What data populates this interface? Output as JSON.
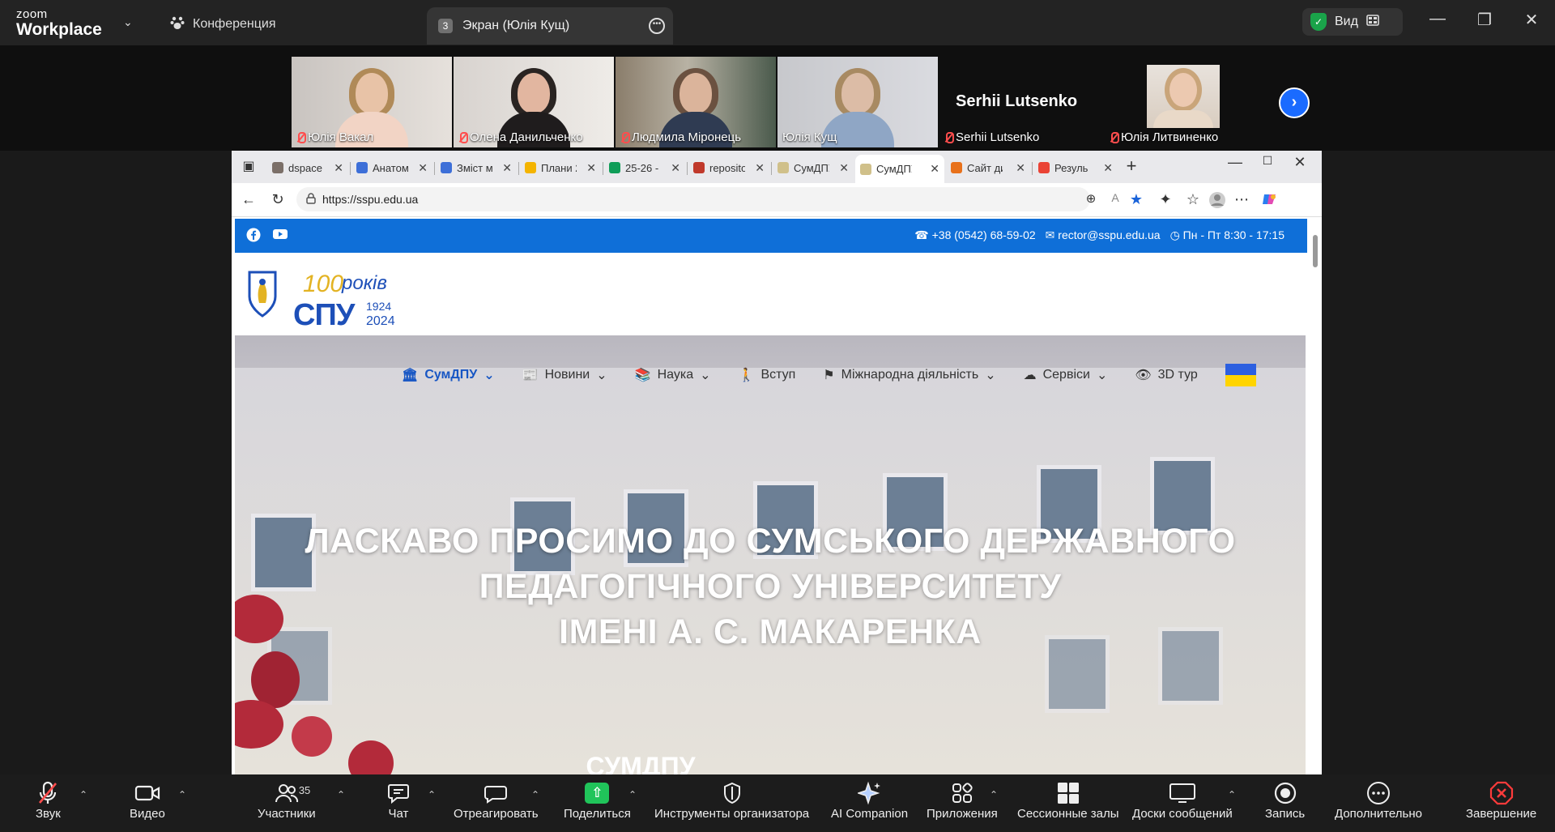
{
  "zoom": {
    "logo_line1": "zoom",
    "logo_line2": "Workplace",
    "conference_label": "Конференция",
    "screen_tab_num": "3",
    "screen_tab_label": "Экран (Юлія Кущ)",
    "view_label": "Вид",
    "window_controls": [
      "minimize-icon",
      "restore-icon",
      "close-icon"
    ]
  },
  "participants": {
    "tiles": [
      {
        "name": "Юлія Вакал",
        "muted": true
      },
      {
        "name": "Олена Данильченко",
        "muted": true
      },
      {
        "name": "Людмила Міронець",
        "muted": true
      },
      {
        "name": "Юлія Кущ",
        "muted": false,
        "active": true
      },
      {
        "name": "Serhii Lutsenko",
        "muted": true,
        "video_off": true
      },
      {
        "name": "Юлія Литвиненко",
        "muted": true
      }
    ],
    "video_off_big_name": "Serhii Lutsenko"
  },
  "browser": {
    "tabs": [
      {
        "title": "dspace",
        "favicon": "#7b6f68"
      },
      {
        "title": "Анатом",
        "favicon": "#3d6fd8"
      },
      {
        "title": "Зміст м",
        "favicon": "#3d6fd8"
      },
      {
        "title": "Плани 2",
        "favicon": "#f4b400"
      },
      {
        "title": "25-26 -",
        "favicon": "#0f9d58"
      },
      {
        "title": "reposito",
        "favicon": "#c0392b"
      },
      {
        "title": "СумДПУ",
        "favicon": "#d0c08a"
      },
      {
        "title": "СумДПУ",
        "favicon": "#d0c08a",
        "current": true
      },
      {
        "title": "Сайт ди",
        "favicon": "#e8711b"
      },
      {
        "title": "Резуль",
        "favicon": "#ea4335"
      }
    ],
    "url": "https://sspu.edu.ua"
  },
  "site": {
    "phone": "+38 (0542) 68-59-02",
    "email": "rector@sspu.edu.ua",
    "hours": "Пн - Пт 8:30 - 17:15",
    "logo_100": "100",
    "logo_rokiv": "років",
    "logo_spu": "СПУ",
    "logo_year1": "1924",
    "logo_year2": "2024",
    "menu": [
      {
        "label": "СумДПУ",
        "icon": "university-icon",
        "dropdown": true,
        "selected": true
      },
      {
        "label": "Новини",
        "icon": "newspaper-icon",
        "dropdown": true
      },
      {
        "label": "Наука",
        "icon": "book-icon",
        "dropdown": true
      },
      {
        "label": "Вступ",
        "icon": "person-walking-icon",
        "dropdown": false
      },
      {
        "label": "Міжнародна діяльність",
        "icon": "flag-icon",
        "dropdown": true
      },
      {
        "label": "Сервіси",
        "icon": "cloud-icon",
        "dropdown": true
      },
      {
        "label": "3D тур",
        "icon": "eye-icon",
        "dropdown": false
      }
    ],
    "hero_line1": "ЛАСКАВО ПРОСИМО ДО СУМСЬКОГО ДЕРЖАВНОГО",
    "hero_line2": "ПЕДАГОГІЧНОГО УНІВЕРСИТЕТУ",
    "hero_line3": "ІМЕНІ А. С. МАКАРЕНКА",
    "hero_sub": "СУМДПУ"
  },
  "toolbar": {
    "items": [
      {
        "label": "Звук",
        "icon": "mic-muted-icon",
        "caret": true
      },
      {
        "label": "Видео",
        "icon": "video-icon",
        "caret": true
      },
      {
        "label": "Участники",
        "icon": "participants-icon",
        "caret": true,
        "count": "35"
      },
      {
        "label": "Чат",
        "icon": "chat-icon",
        "caret": true
      },
      {
        "label": "Отреагировать",
        "icon": "heart-icon",
        "caret": true
      },
      {
        "label": "Поделиться",
        "icon": "share-screen-icon",
        "caret": true
      },
      {
        "label": "Инструменты организатора",
        "icon": "shield-icon",
        "caret": false
      },
      {
        "label": "AI Companion",
        "icon": "ai-sparkle-icon",
        "caret": false
      },
      {
        "label": "Приложения",
        "icon": "apps-icon",
        "caret": true
      },
      {
        "label": "Сессионные залы",
        "icon": "breakout-rooms-icon",
        "caret": false
      },
      {
        "label": "Доски сообщений",
        "icon": "whiteboard-icon",
        "caret": true
      },
      {
        "label": "Запись",
        "icon": "record-icon",
        "caret": false
      },
      {
        "label": "Дополнительно",
        "icon": "more-icon",
        "caret": false
      },
      {
        "label": "Завершение",
        "icon": "end-icon",
        "caret": false
      }
    ]
  }
}
